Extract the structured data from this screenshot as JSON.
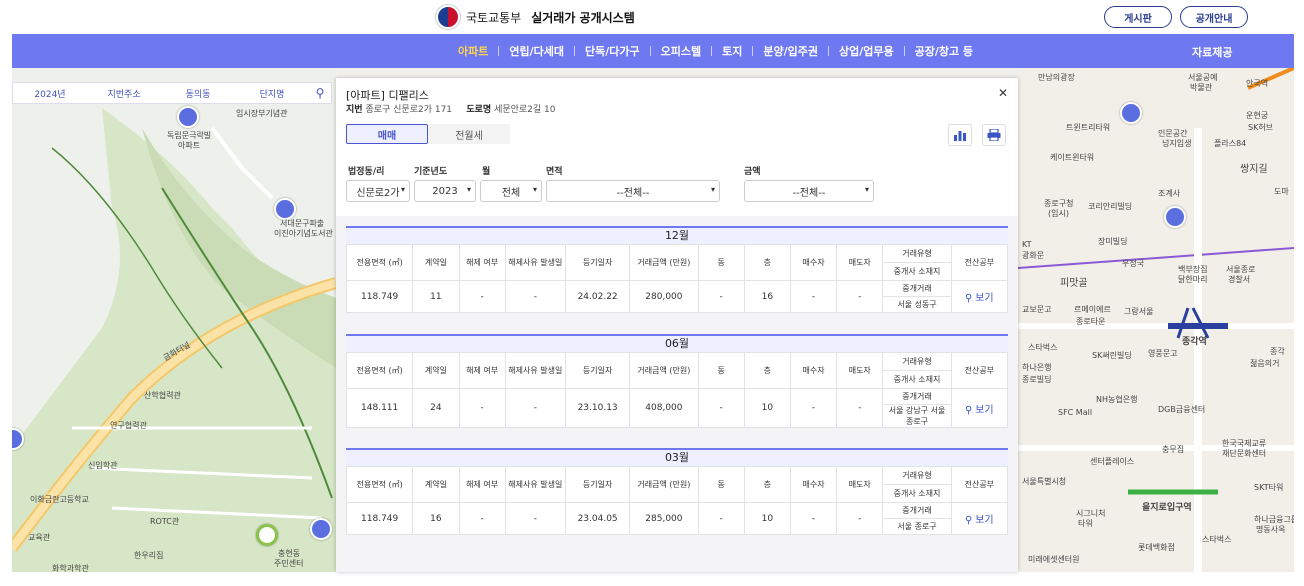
{
  "header": {
    "org": "국토교통부",
    "system": "실거래가 공개시스템",
    "buttons": [
      "게시판",
      "공개안내"
    ]
  },
  "nav": {
    "items": [
      "아파트",
      "연립/다세대",
      "단독/다가구",
      "오피스텔",
      "토지",
      "분양/입주권",
      "상업/업무용",
      "공장/창고 등"
    ],
    "active": "아파트",
    "right": "자료제공"
  },
  "map_filter": {
    "items": [
      "2024년",
      "지번주소",
      "동의동",
      "단지명"
    ]
  },
  "map_labels_left": [
    "독립문극락빌",
    "아파트",
    "서대문구파출",
    "이진아기념도서관",
    "임시장부기념관",
    "금화터널",
    "산학협력관",
    "연구협력관",
    "신입학관",
    "이화금란고등학교",
    "ROTC관",
    "교육관",
    "한우리집",
    "충현동",
    "주민센터",
    "화학과학관"
  ],
  "map_labels_right": [
    "만남의광장",
    "서울공예",
    "박물관",
    "트윈트리타워",
    "인문공간",
    "넝지입생",
    "케이트윈타워",
    "플라스84",
    "쌍지길",
    "조계사",
    "종로구청",
    "(임시)",
    "코리안리빌딩",
    "장미빌딩",
    "우정국",
    "백부장집",
    "닭한마리",
    "서울종로",
    "경찰서",
    "KT",
    "광화문",
    "피맛골",
    "교보문고",
    "르메이에르",
    "종로타운",
    "그랑서울",
    "SK써린빌딩",
    "영풍문고",
    "종각역",
    "종각",
    "젊음의거",
    "스타벅스",
    "하나은행",
    "종로빌딩",
    "SFC Mall",
    "NH농협은행",
    "DGB금융센터",
    "한국국제교류",
    "재단문화센터",
    "센터플레이스",
    "충무집",
    "서울특별시청",
    "SKT타워",
    "시그니처",
    "타워",
    "을지로입구역",
    "하나금융그룹",
    "명동사옥",
    "롯데백화점",
    "스타벅스",
    "미래에셋센터원",
    "안국역",
    "운현궁",
    "SK허브",
    "도마"
  ],
  "panel": {
    "title": "[아파트] 디팰리스",
    "jibun_label": "지번",
    "jibun": "종로구 신문로2가 171",
    "road_label": "도로명",
    "road": "세문안로2길 10",
    "tabs": [
      "매매",
      "전월세"
    ],
    "filters": {
      "dong_label": "법정동/리",
      "dong_value": "신문로2가",
      "year_label": "기준년도",
      "year_value": "2023",
      "month_label": "월",
      "month_value": "전체",
      "area_label": "면적",
      "area_value": "--전체--",
      "price_label": "금액",
      "price_value": "--전체--"
    },
    "columns": {
      "area": "전용면적 (㎡)",
      "contract_day": "계약일",
      "cancel": "해제 여부",
      "cancel_date": "해제사유 발생일",
      "reg_date": "등기일자",
      "price": "거래금액 (만원)",
      "dong": "동",
      "floor": "층",
      "buyer": "매수자",
      "seller": "매도자",
      "deal_type": "거래유형",
      "broker_loc": "중개사 소재지",
      "ledger": "전산공부"
    },
    "view_label": "보기",
    "months": [
      {
        "month": "12월",
        "area": "118.749",
        "day": "11",
        "cancel": "-",
        "cancel_date": "-",
        "reg_date": "24.02.22",
        "price": "280,000",
        "dong": "-",
        "floor": "16",
        "buyer": "-",
        "seller": "-",
        "deal_type": "중개거래",
        "broker": "서울 성동구"
      },
      {
        "month": "06월",
        "area": "148.111",
        "day": "24",
        "cancel": "-",
        "cancel_date": "-",
        "reg_date": "23.10.13",
        "price": "408,000",
        "dong": "-",
        "floor": "10",
        "buyer": "-",
        "seller": "-",
        "deal_type": "중개거래",
        "broker": "서울 강남구 서울 종로구"
      },
      {
        "month": "03월",
        "area": "118.749",
        "day": "16",
        "cancel": "-",
        "cancel_date": "-",
        "reg_date": "23.04.05",
        "price": "285,000",
        "dong": "-",
        "floor": "10",
        "buyer": "-",
        "seller": "-",
        "deal_type": "중개거래",
        "broker": "서울 종로구"
      }
    ]
  },
  "colors": {
    "nav": "#6e78f0",
    "active": "#ffd84d",
    "accent": "#4a57d0"
  }
}
